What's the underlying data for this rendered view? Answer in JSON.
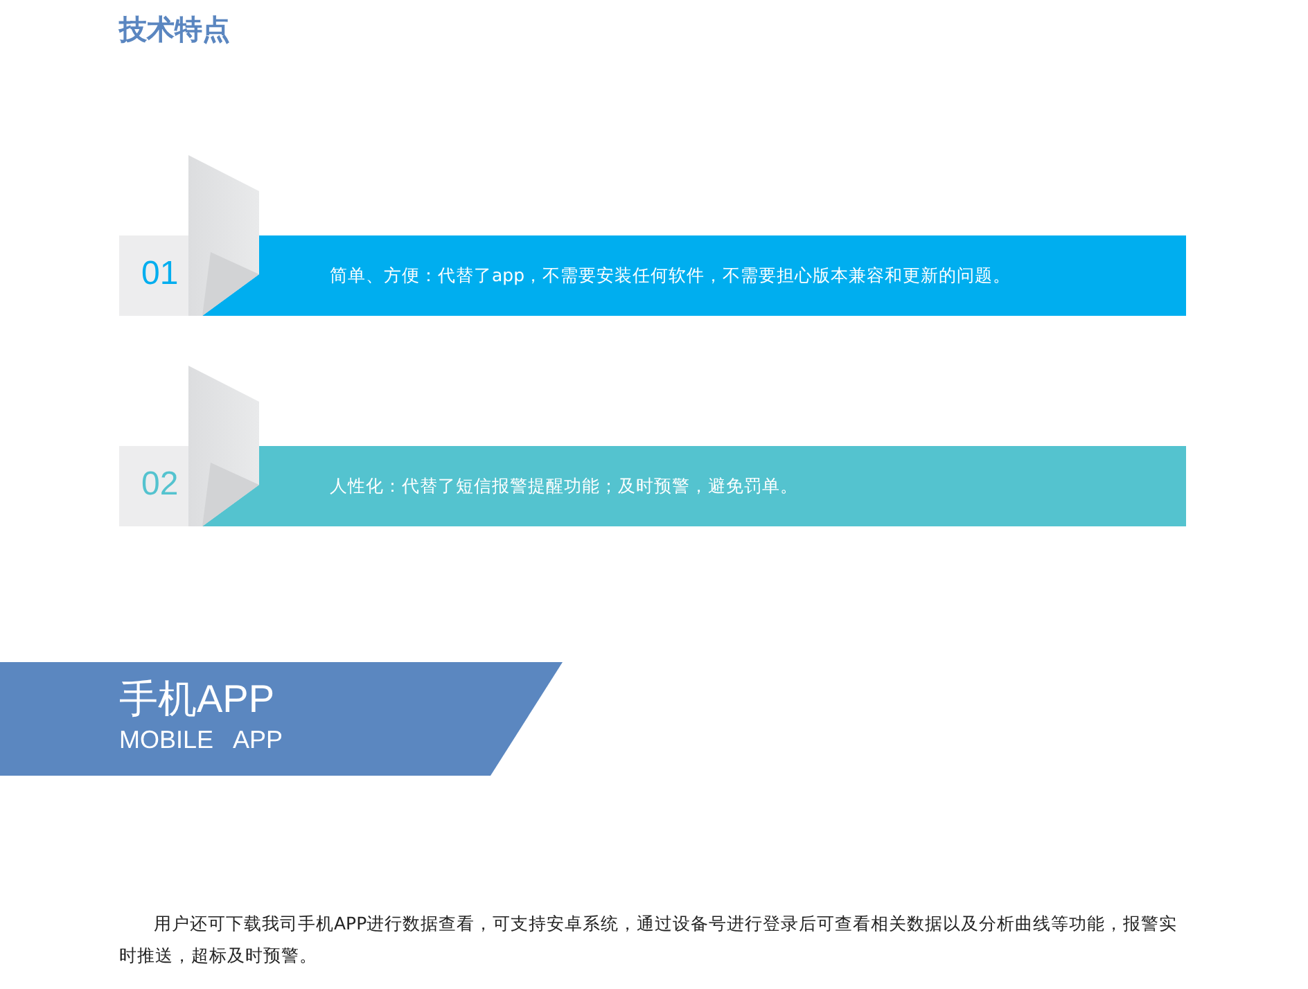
{
  "heading": "技术特点",
  "features": [
    {
      "number": "01",
      "text": "简单、方便：代替了app，不需要安装任何软件，不需要担心版本兼容和更新的问题。",
      "color": "#00aeef"
    },
    {
      "number": "02",
      "text": "人性化：代替了短信报警提醒功能；及时预警，避免罚单。",
      "color": "#54c3cf"
    }
  ],
  "banner": {
    "title": "手机APP",
    "subtitle": "MOBILE   APP"
  },
  "paragraph": "用户还可下载我司手机APP进行数据查看，可支持安卓系统，通过设备号进行登录后可查看相关数据以及分析曲线等功能，报警实时推送，超标及时预警。"
}
